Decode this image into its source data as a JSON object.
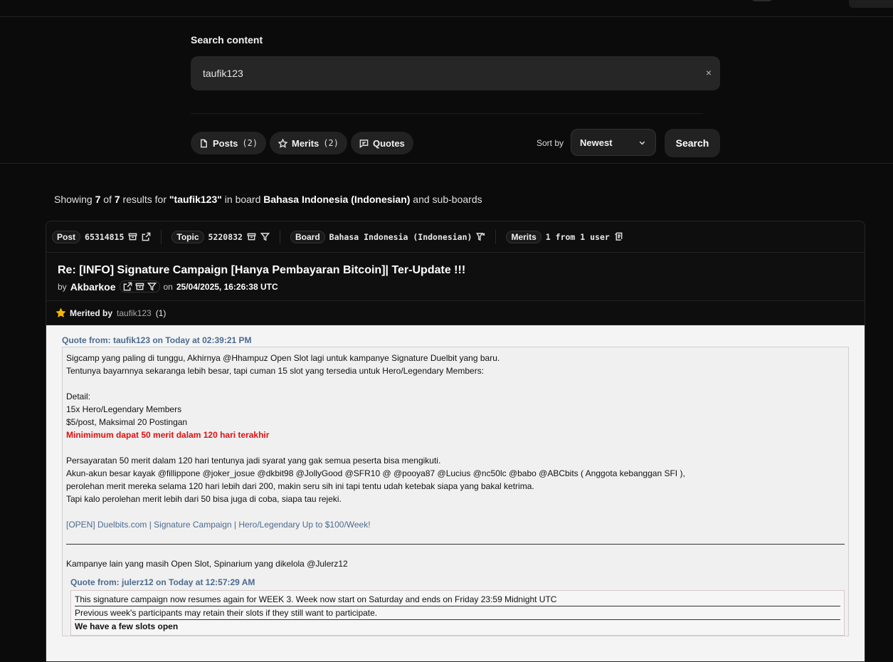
{
  "search": {
    "label": "Search content",
    "value": "taufik123",
    "clear": "×"
  },
  "tabs": {
    "posts_label": "Posts",
    "posts_count": "(2)",
    "merits_label": "Merits",
    "merits_count": "(2)",
    "quotes_label": "Quotes"
  },
  "sort": {
    "label": "Sort by",
    "value": "Newest",
    "button": "Search"
  },
  "summary": {
    "prefix": "Showing ",
    "shown": "7",
    "of": " of ",
    "total": "7",
    "results_for": " results for ",
    "query": "\"taufik123\"",
    "in_board": " in board ",
    "board": "Bahasa Indonesia (Indonesian)",
    "suffix": " and sub-boards"
  },
  "post": {
    "post_tag": "Post",
    "post_id": "65314815",
    "topic_tag": "Topic",
    "topic_id": "5220832",
    "board_tag": "Board",
    "board_name": "Bahasa Indonesia (Indonesian)",
    "merits_tag": "Merits",
    "merits_value": "1 from 1 user",
    "title": "Re: [INFO] Signature Campaign [Hanya Pembayaran Bitcoin]| Ter-Update !!!",
    "by": "by",
    "author": "Akbarkoe",
    "on": "on",
    "date": "25/04/2025, 16:26:38 UTC",
    "merited_by_label": "Merited by",
    "merited_by_user": "taufik123",
    "merited_by_count": "(1)"
  },
  "body": {
    "quote_header": "Quote from: taufik123 on Today at 02:39:21 PM",
    "lines": [
      "Sigcamp yang paling di tunggu, Akhirnya @Hhampuz Open Slot lagi untuk kampanye Signature Duelbit yang baru.",
      "Tentunya bayarnnya sekaranga lebih besar, tapi cuman 15 slot yang tersedia untuk Hero/Legendary Members:",
      "Detail:",
      "15x Hero/Legendary Members",
      "$5/post, Maksimal 20 Postingan",
      "Minimimum dapat 50 merit dalam 120 hari terakhir",
      "Persayaratan 50 merit dalam 120 hari tentunya jadi syarat yang gak semua peserta bisa mengikuti.",
      "Akun-akun besar kayak @fillippone @joker_josue @dkbit98 @JollyGood @SFR10 @ @pooya87 @Lucius @nc50lc @babo @ABCbits ( Anggota kebanggan SFI ),",
      "perolehan merit mereka selama 120 hari lebih dari 200, makin seru sih ini tapi tentu udah ketebak siapa yang bakal ketrima.",
      "Tapi kalo perolehan merit lebih dari 50 bisa juga di coba, siapa tau rejeki.",
      "[OPEN] Duelbits.com | Signature Campaign | Hero/Legendary Up to $100/Week!",
      "Kampanye lain yang masih Open Slot, Spinarium yang dikelola @Julerz12"
    ],
    "inner_quote_header": "Quote from: julerz12 on Today at 12:57:29 AM",
    "inner_lines": [
      "This signature campaign now resumes again for WEEK 3. Week now start on Saturday and ends on Friday 23:59 Midnight UTC",
      "Previous week's participants may retain their slots if they still want to participate.",
      "We have a few slots open"
    ]
  },
  "colors": {
    "background": "#0b0b0b",
    "quote_link": "#4b6b8f",
    "highlight_red": "#e01010",
    "star": "#f5b400"
  }
}
